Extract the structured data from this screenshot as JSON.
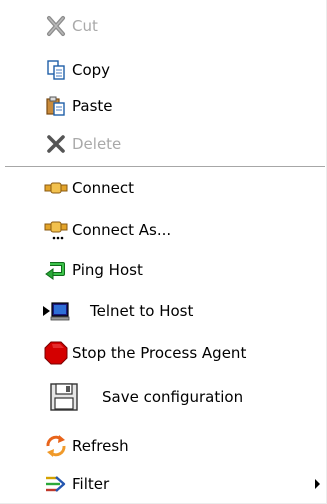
{
  "menu": {
    "items": [
      {
        "label": "Cut",
        "icon": "cut-icon",
        "enabled": false
      },
      {
        "label": "Copy",
        "icon": "copy-icon",
        "enabled": true
      },
      {
        "label": "Paste",
        "icon": "paste-icon",
        "enabled": true
      },
      {
        "label": "Delete",
        "icon": "delete-icon",
        "enabled": false
      },
      {
        "label": "Connect",
        "icon": "plug-icon",
        "enabled": true
      },
      {
        "label": "Connect As...",
        "icon": "plug-user-icon",
        "enabled": true
      },
      {
        "label": "Ping Host",
        "icon": "ping-arrow-icon",
        "enabled": true
      },
      {
        "label": "Telnet to Host",
        "icon": "terminal-icon",
        "enabled": true
      },
      {
        "label": "Stop the Process Agent",
        "icon": "stop-icon",
        "enabled": true
      },
      {
        "label": "Save configuration",
        "icon": "floppy-disk-icon",
        "enabled": true
      },
      {
        "label": "Refresh",
        "icon": "refresh-icon",
        "enabled": true
      },
      {
        "label": "Filter",
        "icon": "filter-icon",
        "enabled": true,
        "has_submenu": true
      }
    ]
  },
  "colors": {
    "disabled_text": "#a9a9a9",
    "separator": "#a7a7a7",
    "stop_red": "#d40000",
    "ping_green": "#1e9c2a"
  }
}
